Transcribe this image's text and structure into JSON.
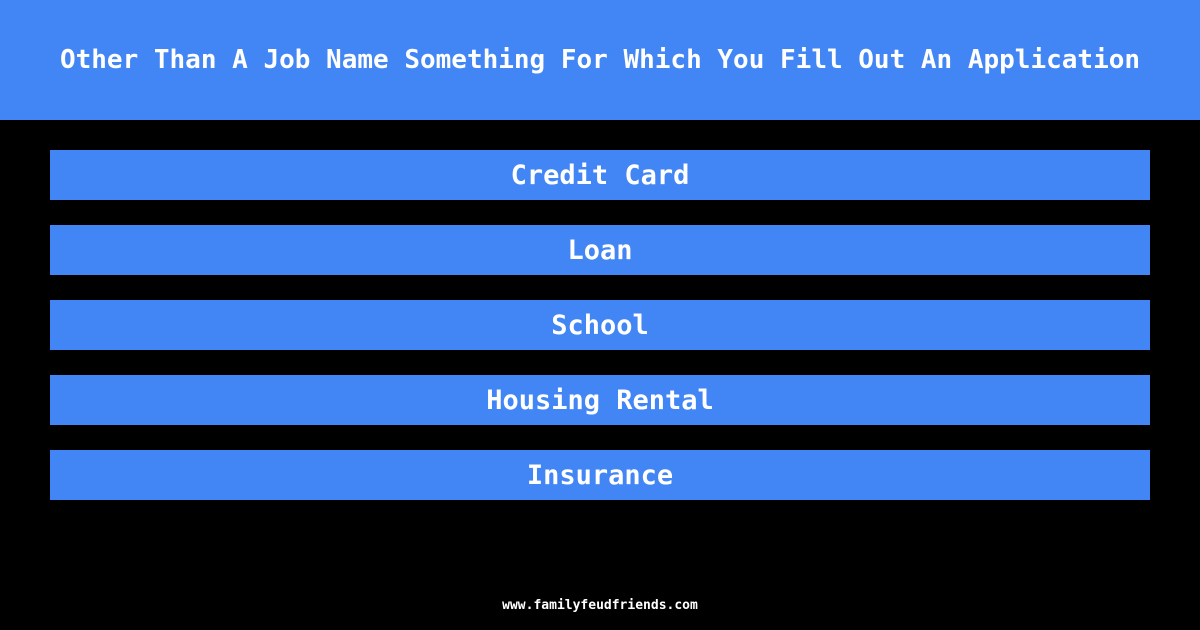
{
  "question": "Other Than A Job Name Something For Which You Fill Out An Application",
  "answers": [
    {
      "label": "Credit Card"
    },
    {
      "label": "Loan"
    },
    {
      "label": "School"
    },
    {
      "label": "Housing Rental"
    },
    {
      "label": "Insurance"
    }
  ],
  "footer": "www.familyfeudfriends.com",
  "colors": {
    "accent": "#4285f4",
    "background": "#000000",
    "text": "#ffffff"
  }
}
